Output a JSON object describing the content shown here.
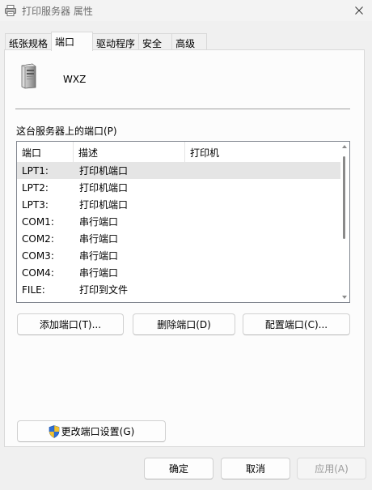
{
  "window": {
    "title": "打印服务器 属性"
  },
  "tabs": [
    {
      "label": "纸张规格",
      "active": false
    },
    {
      "label": "端口",
      "active": true
    },
    {
      "label": "驱动程序",
      "active": false
    },
    {
      "label": "安全",
      "active": false
    },
    {
      "label": "高级",
      "active": false
    }
  ],
  "server": {
    "name": "WXZ"
  },
  "ports_section": {
    "label": "这台服务器上的端口(P)",
    "columns": [
      "端口",
      "描述",
      "打印机"
    ],
    "rows": [
      {
        "port": "LPT1:",
        "description": "打印机端口",
        "printer": "",
        "selected": true
      },
      {
        "port": "LPT2:",
        "description": "打印机端口",
        "printer": "",
        "selected": false
      },
      {
        "port": "LPT3:",
        "description": "打印机端口",
        "printer": "",
        "selected": false
      },
      {
        "port": "COM1:",
        "description": "串行端口",
        "printer": "",
        "selected": false
      },
      {
        "port": "COM2:",
        "description": "串行端口",
        "printer": "",
        "selected": false
      },
      {
        "port": "COM3:",
        "description": "串行端口",
        "printer": "",
        "selected": false
      },
      {
        "port": "COM4:",
        "description": "串行端口",
        "printer": "",
        "selected": false
      },
      {
        "port": "FILE:",
        "description": "打印到文件",
        "printer": "",
        "selected": false
      }
    ]
  },
  "port_buttons": {
    "add": "添加端口(T)...",
    "delete": "删除端口(D)",
    "configure": "配置端口(C)..."
  },
  "change_settings_button": "更改端口设置(G)",
  "dialog_buttons": {
    "ok": "确定",
    "cancel": "取消",
    "apply": "应用(A)"
  },
  "icons": {
    "title": "printer-icon",
    "close": "close-icon",
    "server": "server-tower-icon",
    "shield": "uac-shield-icon"
  },
  "colors": {
    "window_bg": "#f0f0f0",
    "panel_bg": "#fcfcfc",
    "selected_row": "#e5e5e5",
    "disabled_text": "#9a9a9a"
  }
}
